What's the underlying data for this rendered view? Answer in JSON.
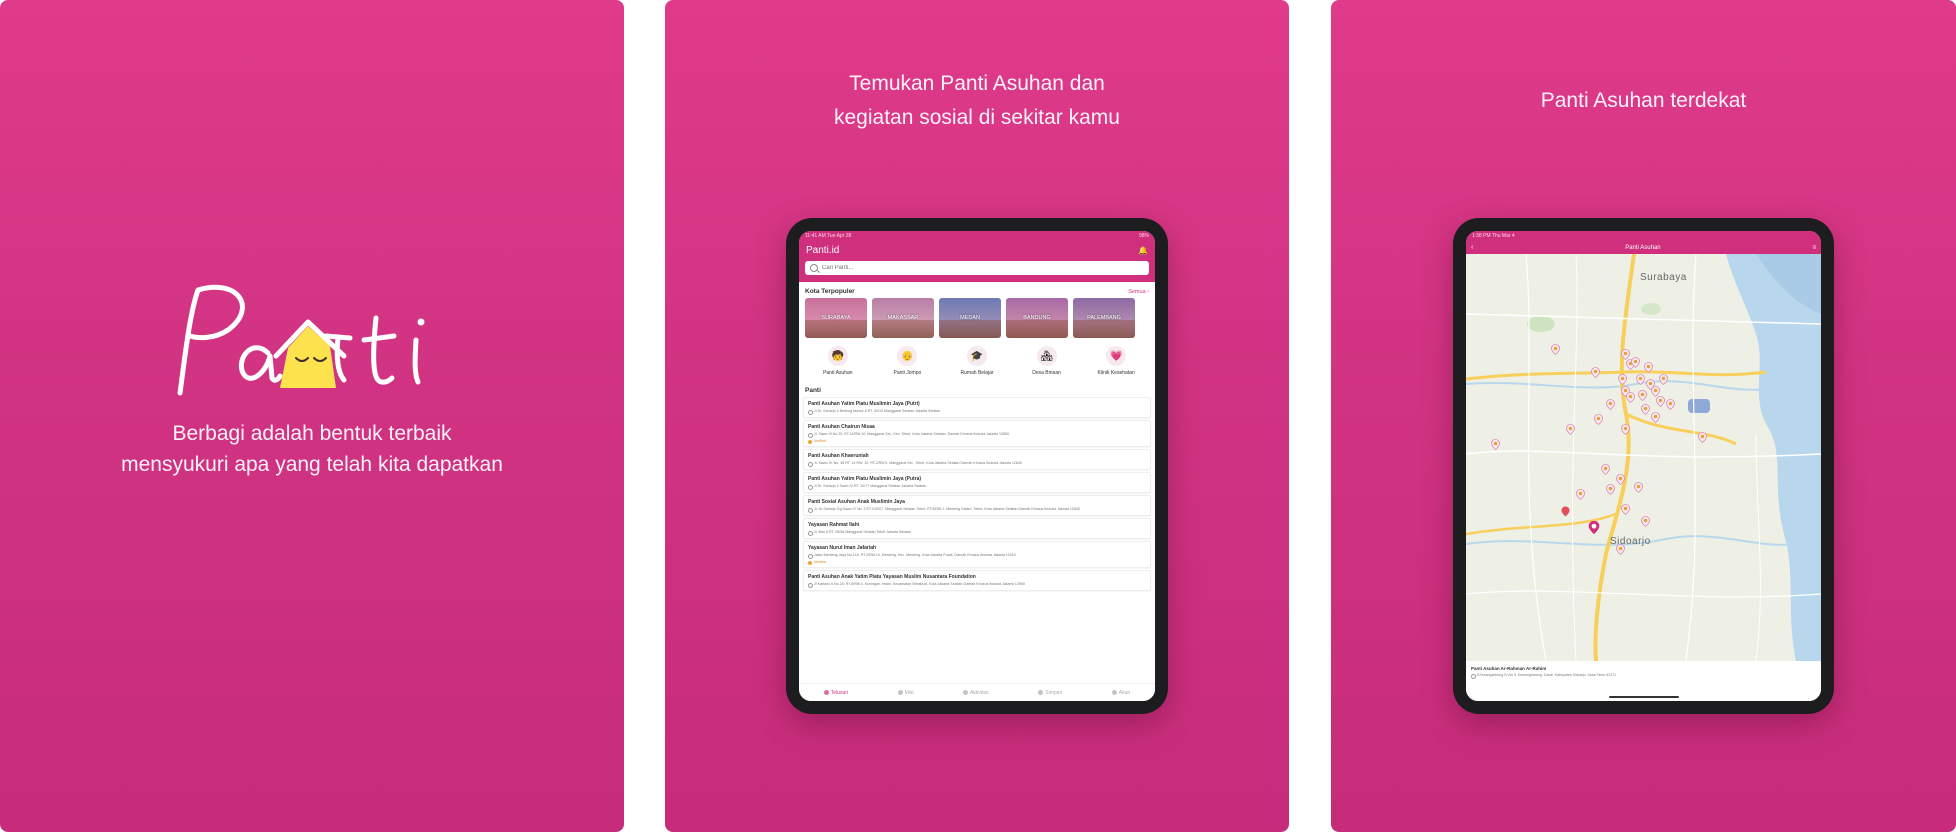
{
  "panel1": {
    "logo_text": "Panti",
    "tagline_line1": "Berbagi adalah bentuk terbaik",
    "tagline_line2": "mensyukuri apa yang telah kita dapatkan"
  },
  "panel2": {
    "caption_line1": "Temukan Panti Asuhan dan",
    "caption_line2": "kegiatan sosial di sekitar kamu",
    "status": {
      "time": "11:41 AM   Tue Apr 28",
      "battery": "98%"
    },
    "app_title": "Panti.id",
    "search_placeholder": "Cari Panti...",
    "popular_title": "Kota Terpopuler",
    "see_all": "Semua ›",
    "cities": [
      "SURABAYA",
      "MAKASSAR",
      "MEDAN",
      "BANDUNG",
      "PALEMBANG"
    ],
    "categories": [
      {
        "label": "Panti Asuhan",
        "icon": "🧒"
      },
      {
        "label": "Panti Jompo",
        "icon": "👴"
      },
      {
        "label": "Rumah Belajar",
        "icon": "🎓"
      },
      {
        "label": "Desa Binaan",
        "icon": "🏘"
      },
      {
        "label": "Klinik Kesehatan",
        "icon": "💗"
      }
    ],
    "list_title": "Panti",
    "items": [
      {
        "name": "Panti Asuhan Yatim Piatu Muslimin Jaya (Putri)",
        "addr": "Jl Dr. Saharjo 4 Bedeng Nomor 8 RT. 02/10 Manggarai Selatan Jakarta Selatan",
        "badge": ""
      },
      {
        "name": "Panti Asuhan Chairun Nisaa",
        "addr": "Jl. Sawo III No.29, RT.14/RW.10, Manggarai Sel., Kec. Tebet, Kota Jakarta Selatan, Daerah Khusus Ibukota Jakarta 12860",
        "badge": "Verified"
      },
      {
        "name": "Panti Asuhan Khaeruniah",
        "addr": "Jl. Sawo IV, No. 35 RT. 14 RW. 10, RT.2/RW.9, Manggarai Sel., Tebet, Kota Jakarta Selatan Daerah Khusus Ibukota Jakarta 12840",
        "badge": ""
      },
      {
        "name": "Panti Asuhan Yatim Piatu Muslimin Jaya (Putra)",
        "addr": "Jl Dr. Saharjo 4 Sawo IV RT. 10/77 Manggarai Selatan Jakarta Selatan",
        "badge": ""
      },
      {
        "name": "Panti Sosial Asuhan Anak Muslimin Jaya",
        "addr": "Jl. Dr Saharjo Gg Sawo IV No. 3 RT 010/07, Manggarai Selatan Tebet, RT.6/RW.1, Menteng Dalam, Tebet, Kota Jakarta Selatan Daerah Khusus Ibukota Jakarta 12840",
        "badge": ""
      },
      {
        "name": "Yayasan Rahmat Ilahi",
        "addr": "Jl. Biru 8 RT. 05/08 Manggarai Selatan Tebet Jakarta Selatan",
        "badge": ""
      },
      {
        "name": "Yayasan Nurul Iman Jafariah",
        "addr": "Jalan Menteng Jaya No.11A, RT.2/RW.10, Menteng, Kec. Menteng, Kota Jakarta Pusat, Daerah Khusus Ibukota Jakarta 10310",
        "badge": "Verified"
      },
      {
        "name": "Panti Asuhan Anak Yatim Piatu Yayasan Muslim Nusantara Foundation",
        "addr": "Jl Kartano 6 No.25, RT.6/RW.4, Kuningan, Imam, Kecamatan Setiabudi, Kota Jakarta Selatan Daerah Khusus Ibukota Jakarta 12980",
        "badge": ""
      }
    ],
    "nav": [
      "Telusuri",
      "Misi",
      "Aktivitas",
      "Simpan",
      "Akun"
    ]
  },
  "panel3": {
    "caption": "Panti Asuhan terdekat",
    "status": {
      "time": "1:38 PM   Thu Mar 4",
      "battery": ""
    },
    "app_title": "Panti Asuhan",
    "map_labels": {
      "north": "Surabaya",
      "south": "Sidoarjo"
    },
    "card_name": "Panti Asuhan Ar-Rahman Ar-Rahim",
    "card_addr": "Jl Kenanganbong IV No 9, Kemangbarang, Candi, Kabupaten Sidoarjo, Jawa Timur 61271"
  },
  "colors": {
    "brand": "#cf2f7d",
    "background": "#d6337f",
    "verified": "#f2a23d"
  }
}
